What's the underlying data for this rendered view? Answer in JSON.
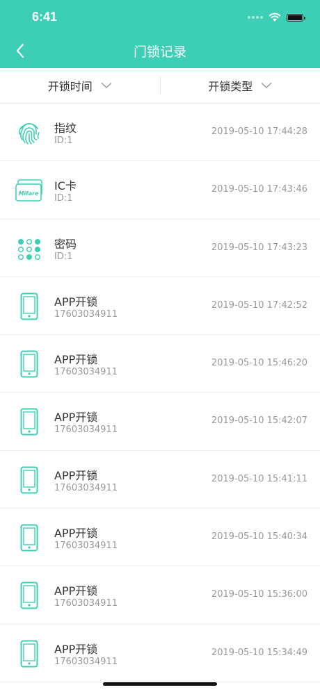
{
  "status": {
    "time": "6:41"
  },
  "header": {
    "title": "门锁记录"
  },
  "filters": [
    {
      "label": "开锁时间"
    },
    {
      "label": "开锁类型"
    }
  ],
  "colors": {
    "accent": "#3ccfb5"
  },
  "records": [
    {
      "icon": "fingerprint-icon",
      "title": "指纹",
      "sub": "ID:1",
      "time": "2019-05-10 17:44:28"
    },
    {
      "icon": "ic-card-icon",
      "title": "IC卡",
      "sub": "ID:1",
      "time": "2019-05-10 17:43:46",
      "card_text": "Mifare"
    },
    {
      "icon": "keypad-icon",
      "title": "密码",
      "sub": "ID:1",
      "time": "2019-05-10 17:43:23"
    },
    {
      "icon": "phone-icon",
      "title": "APP开锁",
      "sub": "17603034911",
      "time": "2019-05-10 17:42:52"
    },
    {
      "icon": "phone-icon",
      "title": "APP开锁",
      "sub": "17603034911",
      "time": "2019-05-10 15:46:20"
    },
    {
      "icon": "phone-icon",
      "title": "APP开锁",
      "sub": "17603034911",
      "time": "2019-05-10 15:42:07"
    },
    {
      "icon": "phone-icon",
      "title": "APP开锁",
      "sub": "17603034911",
      "time": "2019-05-10 15:41:11"
    },
    {
      "icon": "phone-icon",
      "title": "APP开锁",
      "sub": "17603034911",
      "time": "2019-05-10 15:40:34"
    },
    {
      "icon": "phone-icon",
      "title": "APP开锁",
      "sub": "17603034911",
      "time": "2019-05-10 15:36:00"
    },
    {
      "icon": "phone-icon",
      "title": "APP开锁",
      "sub": "17603034911",
      "time": "2019-05-10 15:34:49"
    }
  ]
}
